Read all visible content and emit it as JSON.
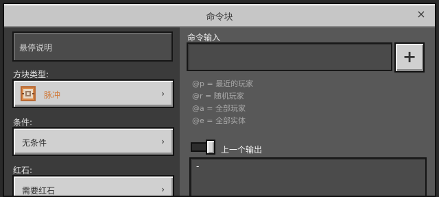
{
  "window": {
    "title": "命令块",
    "close_glyph": "×"
  },
  "left": {
    "hover_note": "悬停说明",
    "block_type": {
      "label": "方块类型:",
      "value": "脉冲",
      "icon": "impulse-command-block-icon"
    },
    "condition": {
      "label": "条件:",
      "value": "无条件"
    },
    "redstone": {
      "label": "红石:",
      "value": "需要红石"
    },
    "chevron": "›"
  },
  "right": {
    "command_label": "命令输入",
    "command_value": "",
    "plus_glyph": "+",
    "hints": [
      "@p = 最近的玩家",
      "@r = 随机玩家",
      "@a = 全部玩家",
      "@e = 全部实体"
    ],
    "previous_output": {
      "label": "上一个输出",
      "toggle_on": true,
      "value": "-"
    }
  },
  "colors": {
    "accent_orange": "#d17a3a",
    "panel_dark": "#3b3b3b",
    "panel_right": "#585858"
  }
}
